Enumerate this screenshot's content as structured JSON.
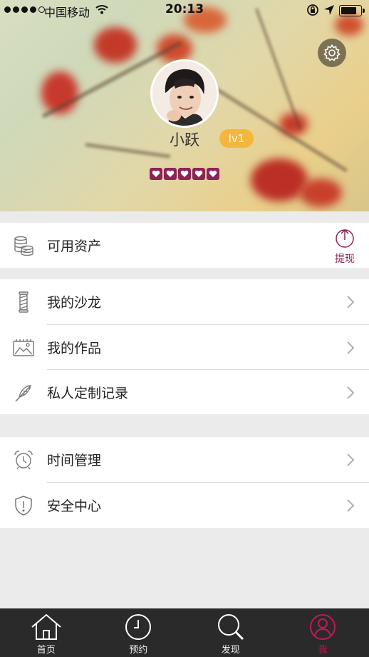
{
  "status_bar": {
    "carrier": "中国移动",
    "time": "20:13",
    "signal_bars": 4,
    "signal_total": 5
  },
  "profile": {
    "username": "小跃",
    "level": "lv1",
    "hearts_count": 5,
    "heart_color": "#8b2457",
    "level_badge_color": "#f3b73d"
  },
  "assets": {
    "label": "可用资产",
    "withdraw_label": "提现"
  },
  "menu_group_1": [
    {
      "label": "我的沙龙",
      "icon": "salon-pole-icon"
    },
    {
      "label": "我的作品",
      "icon": "gallery-icon"
    },
    {
      "label": "私人定制记录",
      "icon": "feather-icon"
    }
  ],
  "menu_group_2": [
    {
      "label": "时间管理",
      "icon": "alarm-clock-icon"
    },
    {
      "label": "安全中心",
      "icon": "shield-icon"
    }
  ],
  "tabs": [
    {
      "label": "首页",
      "icon": "home-icon",
      "active": false
    },
    {
      "label": "预约",
      "icon": "clock-icon",
      "active": false
    },
    {
      "label": "发现",
      "icon": "search-icon",
      "active": false
    },
    {
      "label": "我",
      "icon": "user-icon",
      "active": true
    }
  ],
  "colors": {
    "accent": "#8b2457",
    "active_tab": "#c2185b",
    "tabbar_bg": "#2a2a2a"
  }
}
